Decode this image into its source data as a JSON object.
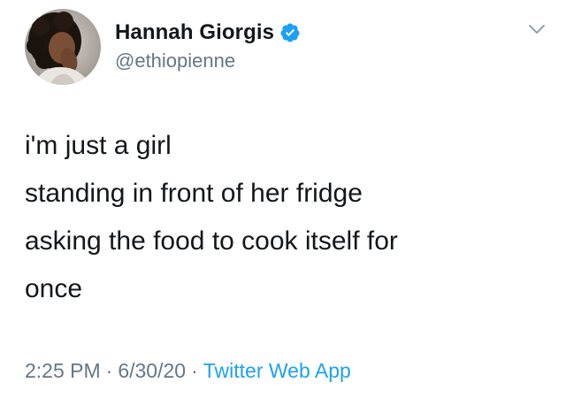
{
  "user": {
    "display_name": "Hannah Giorgis",
    "handle": "@ethiopienne",
    "verified": true,
    "avatar_icon": "profile-photo",
    "verified_icon": "verified-badge-icon"
  },
  "tweet": {
    "lines": [
      "i'm just a girl",
      "standing in front of her fridge",
      "asking the food to cook itself for",
      "once"
    ],
    "time": "2:25 PM",
    "separator": "·",
    "date": "6/30/20",
    "source": "Twitter Web App"
  },
  "menu": {
    "icon": "chevron-down-icon"
  },
  "colors": {
    "text": "#14171a",
    "secondary": "#657786",
    "accent": "#1da1f2"
  }
}
